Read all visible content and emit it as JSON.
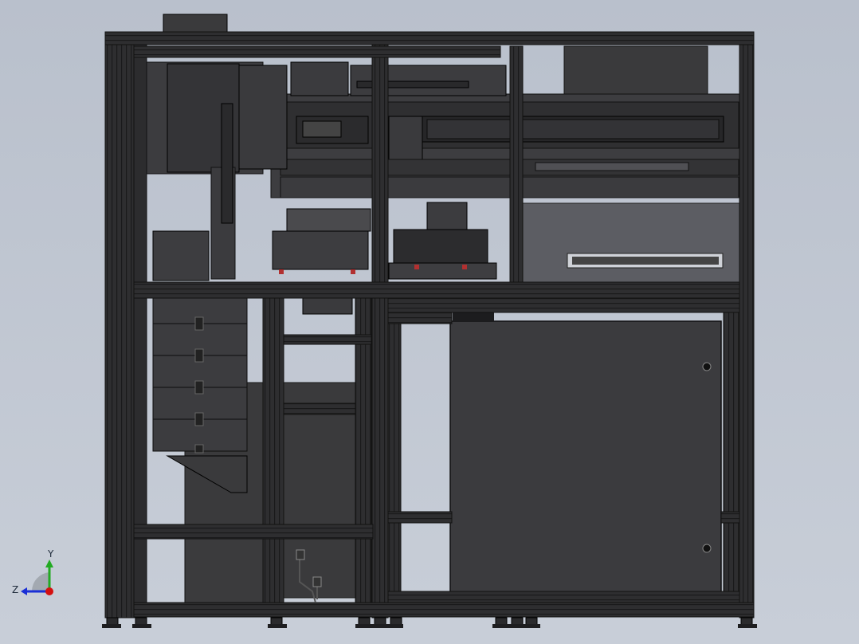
{
  "viewport": {
    "background_top": "#b9c0cc",
    "background_bottom": "#c8ced8"
  },
  "model": {
    "frame_color": "#2b2b2d",
    "frame_edge": "#4a4a4d",
    "panel_color": "#3a3a3c",
    "panel_light": "#6b6b70",
    "accent_red": "#b23030"
  },
  "triad": {
    "y_label": "Y",
    "z_label": "Z",
    "x_color": "#d41010",
    "y_color": "#22aa22",
    "z_color": "#1a2fd6"
  }
}
